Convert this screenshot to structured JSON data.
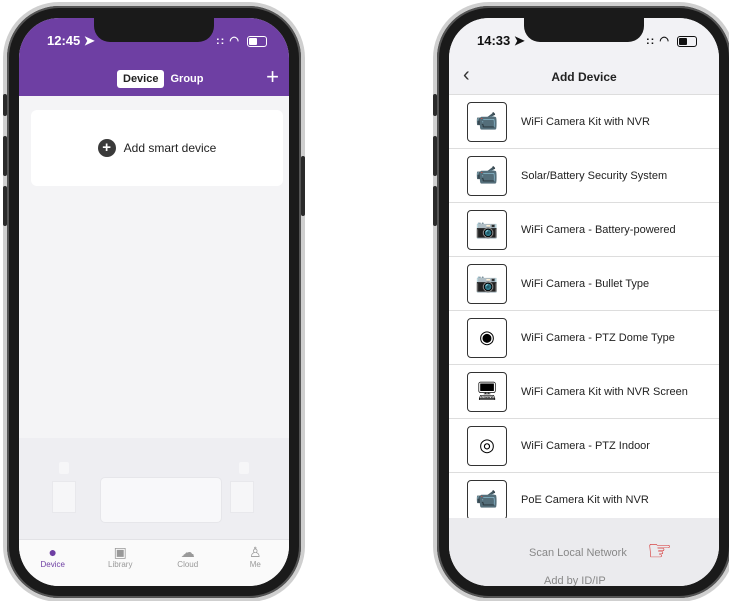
{
  "left_phone": {
    "status": {
      "time": "12:45 ➤",
      "signal": "::",
      "wifi": "◠"
    },
    "segments": [
      "Device",
      "Group"
    ],
    "add_label": "Add smart device",
    "tabs": [
      {
        "label": "Device",
        "icon": "person-circle-icon"
      },
      {
        "label": "Library",
        "icon": "image-icon"
      },
      {
        "label": "Cloud",
        "icon": "cloud-icon"
      },
      {
        "label": "Me",
        "icon": "person-icon"
      }
    ],
    "accent": "#6e3fa3"
  },
  "right_phone": {
    "status": {
      "time": "14:33 ➤",
      "signal": "::",
      "wifi": "◠"
    },
    "title": "Add Device",
    "items": [
      {
        "label": "WiFi Camera Kit with NVR",
        "icon": "camera-nvr-kit-icon"
      },
      {
        "label": "Solar/Battery Security System",
        "icon": "solar-camera-kit-icon"
      },
      {
        "label": "WiFi Camera - Battery-powered",
        "icon": "battery-camera-icon"
      },
      {
        "label": "WiFi Camera - Bullet Type",
        "icon": "bullet-camera-icon"
      },
      {
        "label": "WiFi Camera - PTZ Dome Type",
        "icon": "ptz-dome-camera-icon"
      },
      {
        "label": "WiFi Camera Kit with NVR Screen",
        "icon": "nvr-screen-kit-icon"
      },
      {
        "label": "WiFi Camera - PTZ Indoor",
        "icon": "ptz-indoor-camera-icon"
      },
      {
        "label": "PoE Camera Kit with NVR",
        "icon": "poe-camera-kit-icon"
      }
    ],
    "scan": "Scan Local Network",
    "add_id": "Add by ID/IP",
    "pointer_color": "#d52a2a"
  }
}
